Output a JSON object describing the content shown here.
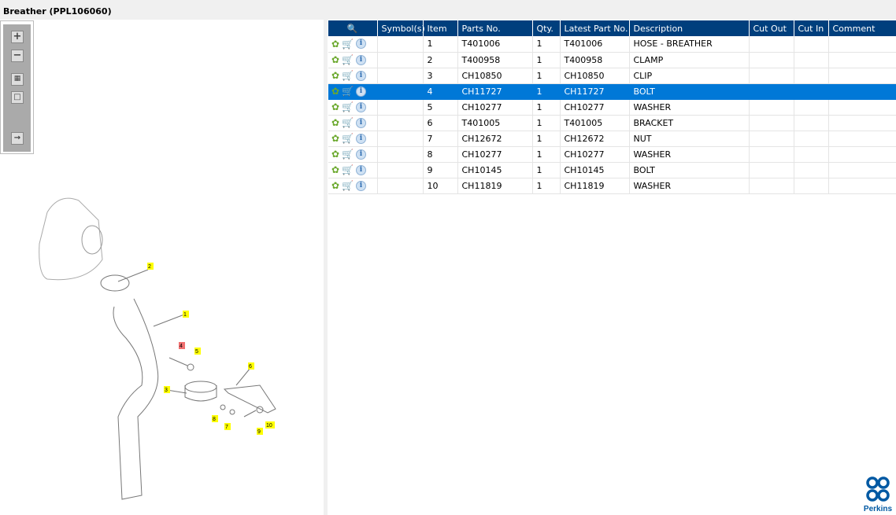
{
  "title": "Breather (PPL106060)",
  "toolbar": {
    "buttons": [
      "zoom-in",
      "zoom-out",
      "fit-all",
      "fit-window",
      "export"
    ]
  },
  "columns": [
    "Symbol(s)",
    "Item",
    "Parts No.",
    "Qty.",
    "Latest Part No.",
    "Description",
    "Cut Out",
    "Cut In",
    "Comment"
  ],
  "rows": [
    {
      "item": "1",
      "part": "T401006",
      "qty": "1",
      "latest": "T401006",
      "desc": "HOSE - BREATHER"
    },
    {
      "item": "2",
      "part": "T400958",
      "qty": "1",
      "latest": "T400958",
      "desc": "CLAMP"
    },
    {
      "item": "3",
      "part": "CH10850",
      "qty": "1",
      "latest": "CH10850",
      "desc": "CLIP"
    },
    {
      "item": "4",
      "part": "CH11727",
      "qty": "1",
      "latest": "CH11727",
      "desc": "BOLT"
    },
    {
      "item": "5",
      "part": "CH10277",
      "qty": "1",
      "latest": "CH10277",
      "desc": "WASHER"
    },
    {
      "item": "6",
      "part": "T401005",
      "qty": "1",
      "latest": "T401005",
      "desc": "BRACKET"
    },
    {
      "item": "7",
      "part": "CH12672",
      "qty": "1",
      "latest": "CH12672",
      "desc": "NUT"
    },
    {
      "item": "8",
      "part": "CH10277",
      "qty": "1",
      "latest": "CH10277",
      "desc": "WASHER"
    },
    {
      "item": "9",
      "part": "CH10145",
      "qty": "1",
      "latest": "CH10145",
      "desc": "BOLT"
    },
    {
      "item": "10",
      "part": "CH11819",
      "qty": "1",
      "latest": "CH11819",
      "desc": "WASHER"
    }
  ],
  "selected_item": "4",
  "callouts": [
    "1",
    "2",
    "3",
    "4",
    "5",
    "6",
    "7",
    "8",
    "9",
    "10"
  ],
  "logo": "Perkins",
  "colors": {
    "header": "#003f7d",
    "selected": "#0078d7",
    "callout": "#ffff00",
    "callout_selected": "#f07070"
  }
}
